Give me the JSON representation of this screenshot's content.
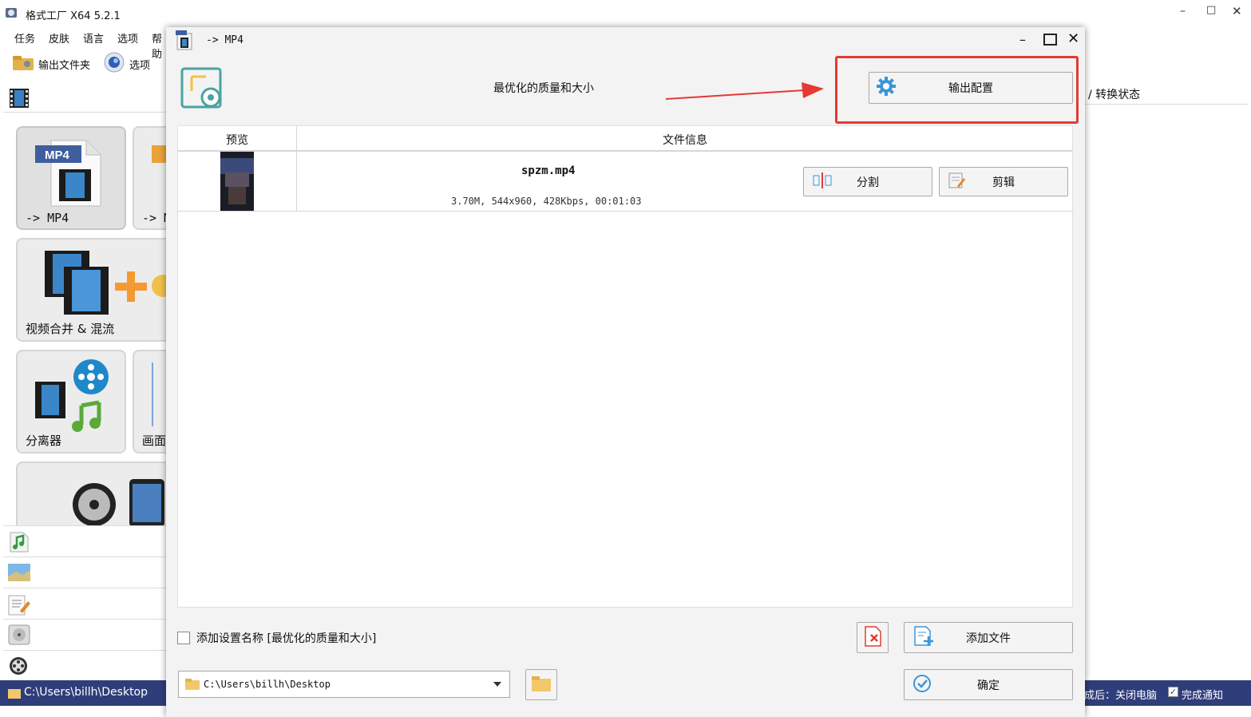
{
  "app": {
    "title": "格式工厂 X64 5.2.1",
    "menu": [
      "任务",
      "皮肤",
      "语言",
      "选项",
      "帮助"
    ],
    "toolbar": {
      "output_folder": "输出文件夹",
      "options": "选项"
    },
    "categories": {
      "mp4_tile": "-> MP4",
      "second_tile": "-> M",
      "merge_tile": "视频合并 & 混流",
      "splitter_tile": "分离器",
      "screen_tile": "画面"
    },
    "right_header": "转换状态",
    "statusbar": {
      "path": "C:\\Users\\billh\\Desktop",
      "after_done": "成后：关闭电脑",
      "notify": "完成通知"
    }
  },
  "dialog": {
    "title": "-> MP4",
    "preset": "最优化的质量和大小",
    "output_config_button": "输出配置",
    "table": {
      "col_preview": "预览",
      "col_fileinfo": "文件信息",
      "rows": [
        {
          "filename": "spzm.mp4",
          "details": "3.70M, 544x960, 428Kbps, 00:01:03",
          "split_button": "分割",
          "clip_button": "剪辑"
        }
      ]
    },
    "add_setting_name_label": "添加设置名称 [最优化的质量和大小]",
    "add_file_button": "添加文件",
    "output_path": "C:\\Users\\billh\\Desktop",
    "confirm_button": "确定"
  },
  "colors": {
    "annotation_red": "#e53935",
    "statusbar_bg": "#2f3e7a",
    "accent_teal": "#4aa3a0",
    "gear_blue": "#3c95d8"
  }
}
